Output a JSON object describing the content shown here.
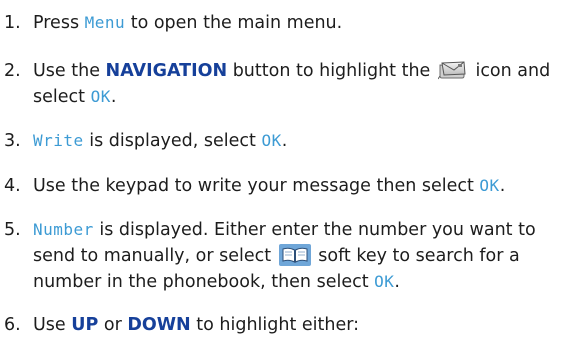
{
  "steps": [
    {
      "num": "1.",
      "t1": "Press ",
      "d1": "Menu",
      "t2": " to open the main menu."
    },
    {
      "num": "2.",
      "t1": "Use the ",
      "k1": "NAVIGATION",
      "t2": " button to highlight the ",
      "icon": "message-envelope-icon",
      "t3": " icon and select ",
      "d1": "OK",
      "t4": "."
    },
    {
      "num": "3.",
      "d1": "Write",
      "t1": " is displayed, select ",
      "d2": "OK",
      "t2": "."
    },
    {
      "num": "4.",
      "t1": "Use the keypad to write your message then select ",
      "d1": "OK",
      "t2": "."
    },
    {
      "num": "5.",
      "d1": "Number",
      "t1": " is displayed. Either enter the number you want to send to manually, or select ",
      "icon": "phonebook-book-icon",
      "t2": " soft key to search for a number in the phonebook, then select ",
      "d2": "OK",
      "t3": "."
    },
    {
      "num": "6.",
      "t1": "Use ",
      "k1": "UP",
      "t2": " or ",
      "k2": "DOWN",
      "t3": " to highlight either:"
    }
  ]
}
